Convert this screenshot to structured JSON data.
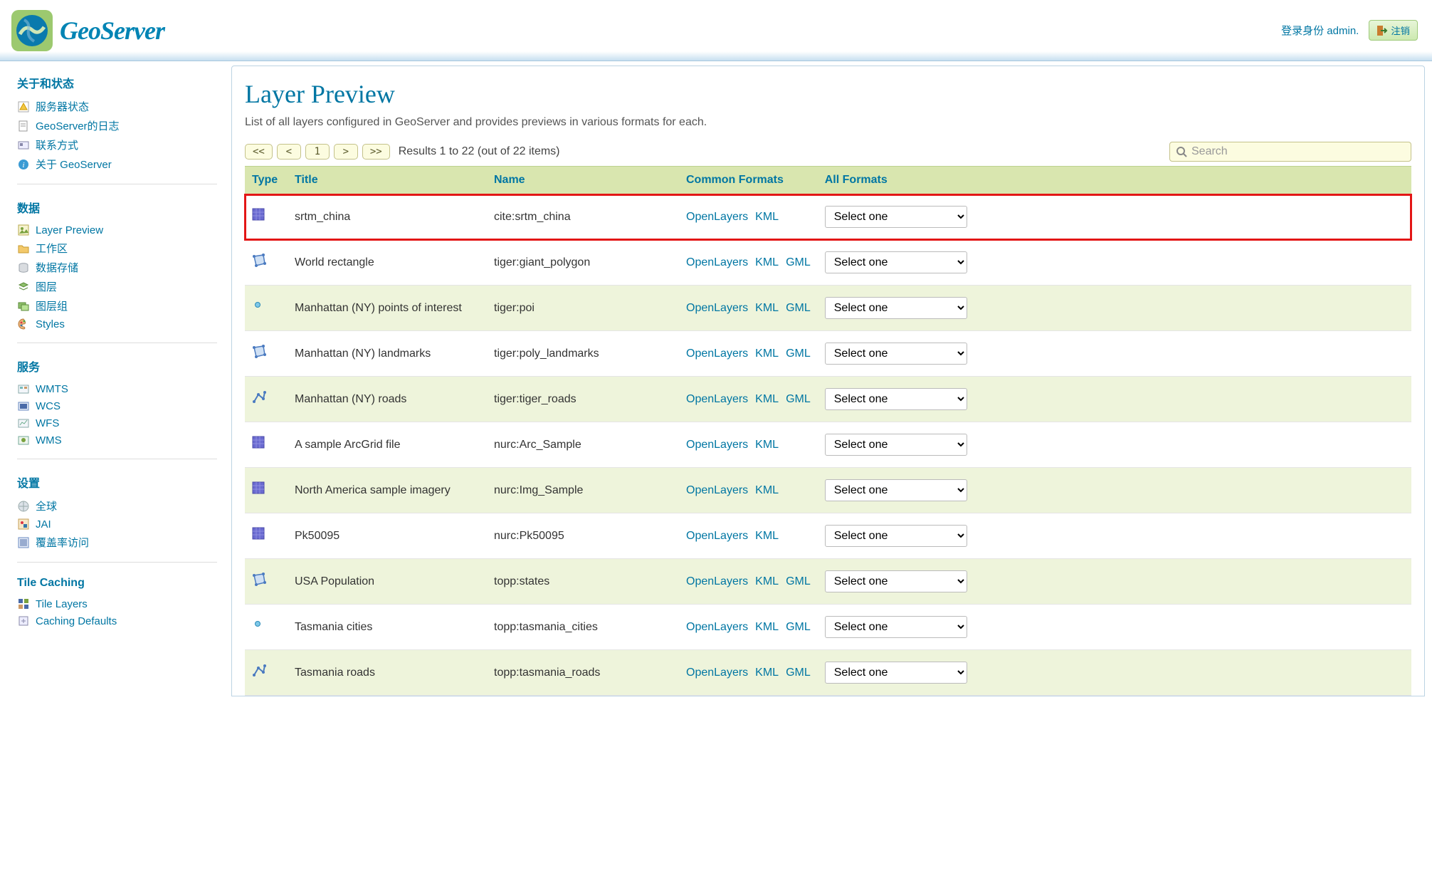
{
  "header": {
    "brand": "GeoServer",
    "login_text": "登录身份 admin.",
    "logout_label": "注销"
  },
  "sidebar": {
    "sections": [
      {
        "title": "关于和状态",
        "items": [
          {
            "label": "服务器状态",
            "icon": "warn"
          },
          {
            "label": "GeoServer的日志",
            "icon": "doc"
          },
          {
            "label": "联系方式",
            "icon": "card"
          },
          {
            "label": "关于 GeoServer",
            "icon": "info"
          }
        ]
      },
      {
        "title": "数据",
        "items": [
          {
            "label": "Layer Preview",
            "icon": "preview"
          },
          {
            "label": "工作区",
            "icon": "folder"
          },
          {
            "label": "数据存储",
            "icon": "db"
          },
          {
            "label": "图层",
            "icon": "layers"
          },
          {
            "label": "图层组",
            "icon": "layergroup"
          },
          {
            "label": "Styles",
            "icon": "palette"
          }
        ]
      },
      {
        "title": "服务",
        "items": [
          {
            "label": "WMTS",
            "icon": "svc-wmts"
          },
          {
            "label": "WCS",
            "icon": "svc-wcs"
          },
          {
            "label": "WFS",
            "icon": "svc-wfs"
          },
          {
            "label": "WMS",
            "icon": "svc-wms"
          }
        ]
      },
      {
        "title": "设置",
        "items": [
          {
            "label": "全球",
            "icon": "globe"
          },
          {
            "label": "JAI",
            "icon": "jai"
          },
          {
            "label": "覆盖率访问",
            "icon": "coverage"
          }
        ]
      },
      {
        "title": "Tile Caching",
        "items": [
          {
            "label": "Tile Layers",
            "icon": "tilelayer"
          },
          {
            "label": "Caching Defaults",
            "icon": "cachedef"
          }
        ]
      }
    ]
  },
  "main": {
    "title": "Layer Preview",
    "description": "List of all layers configured in GeoServer and provides previews in various formats for each.",
    "paging": {
      "first": "<<",
      "prev": "<",
      "page": "1",
      "next": ">",
      "last": ">>",
      "results": "Results 1 to 22 (out of 22 items)"
    },
    "search_placeholder": "Search",
    "columns": {
      "type": "Type",
      "title": "Title",
      "name": "Name",
      "common": "Common Formats",
      "all": "All Formats"
    },
    "format_labels": {
      "openlayers": "OpenLayers",
      "kml": "KML",
      "gml": "GML"
    },
    "select_default": "Select one",
    "rows": [
      {
        "type": "raster",
        "title": "srtm_china",
        "name": "cite:srtm_china",
        "formats": [
          "openlayers",
          "kml"
        ],
        "highlight": true
      },
      {
        "type": "polygon",
        "title": "World rectangle",
        "name": "tiger:giant_polygon",
        "formats": [
          "openlayers",
          "kml",
          "gml"
        ]
      },
      {
        "type": "point",
        "title": "Manhattan (NY) points of interest",
        "name": "tiger:poi",
        "formats": [
          "openlayers",
          "kml",
          "gml"
        ]
      },
      {
        "type": "polygon",
        "title": "Manhattan (NY) landmarks",
        "name": "tiger:poly_landmarks",
        "formats": [
          "openlayers",
          "kml",
          "gml"
        ]
      },
      {
        "type": "line",
        "title": "Manhattan (NY) roads",
        "name": "tiger:tiger_roads",
        "formats": [
          "openlayers",
          "kml",
          "gml"
        ]
      },
      {
        "type": "raster",
        "title": "A sample ArcGrid file",
        "name": "nurc:Arc_Sample",
        "formats": [
          "openlayers",
          "kml"
        ]
      },
      {
        "type": "raster",
        "title": "North America sample imagery",
        "name": "nurc:Img_Sample",
        "formats": [
          "openlayers",
          "kml"
        ]
      },
      {
        "type": "raster",
        "title": "Pk50095",
        "name": "nurc:Pk50095",
        "formats": [
          "openlayers",
          "kml"
        ]
      },
      {
        "type": "polygon",
        "title": "USA Population",
        "name": "topp:states",
        "formats": [
          "openlayers",
          "kml",
          "gml"
        ]
      },
      {
        "type": "point",
        "title": "Tasmania cities",
        "name": "topp:tasmania_cities",
        "formats": [
          "openlayers",
          "kml",
          "gml"
        ]
      },
      {
        "type": "line",
        "title": "Tasmania roads",
        "name": "topp:tasmania_roads",
        "formats": [
          "openlayers",
          "kml",
          "gml"
        ]
      }
    ]
  }
}
